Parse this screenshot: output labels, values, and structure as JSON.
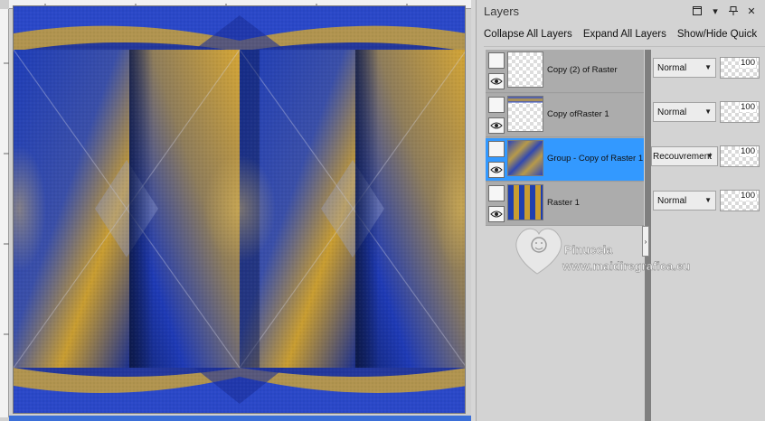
{
  "panel": {
    "title": "Layers",
    "toolbar": {
      "collapse_all": "Collapse All Layers",
      "expand_all": "Expand All Layers",
      "show_hide": "Show/Hide Quick"
    }
  },
  "layers": [
    {
      "name": "Copy (2) of Raster",
      "blend_mode": "Normal",
      "opacity": "100",
      "selected": false
    },
    {
      "name": "Copy ofRaster 1",
      "blend_mode": "Normal",
      "opacity": "100",
      "selected": false
    },
    {
      "name": "Group - Copy of Raster 1",
      "blend_mode": "Recouvrement",
      "opacity": "100",
      "selected": true
    },
    {
      "name": "Raster 1",
      "blend_mode": "Normal",
      "opacity": "100",
      "selected": false
    }
  ],
  "watermark": {
    "name": "Pinuccia",
    "site": "www.maidiregrafica.eu"
  },
  "colors": {
    "selection": "#3399ff",
    "art_blue": "#1f3fb0",
    "art_gold": "#c49a2e"
  }
}
